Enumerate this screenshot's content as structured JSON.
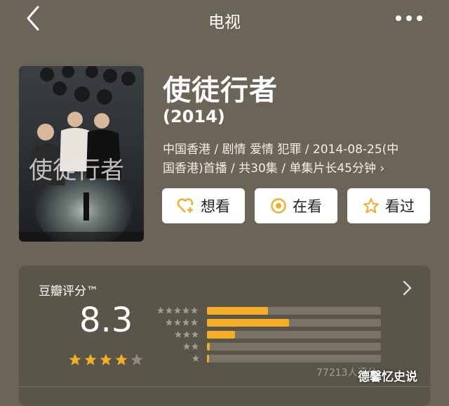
{
  "header": {
    "title": "电视",
    "back_icon": "chevron-left-icon",
    "more_icon": "more-dots-icon"
  },
  "show": {
    "title": "使徒行者",
    "year": "(2014)",
    "meta_line1": "中国香港 / 剧情 爱情 犯罪 / 2014-08-25(中",
    "meta_line2": "国香港)首播 / 共30集 / 单集片长45分钟",
    "poster_title": "使徒行者"
  },
  "actions": [
    {
      "label": "想看",
      "icon": "heart-plus-icon"
    },
    {
      "label": "在看",
      "icon": "target-circle-icon"
    },
    {
      "label": "看过",
      "icon": "star-outline-icon"
    }
  ],
  "rating": {
    "label": "豆瓣评分™",
    "score": "8.3",
    "stars_filled": 4,
    "stars_total": 5,
    "distribution": [
      {
        "stars": 5,
        "fraction": 0.35
      },
      {
        "stars": 4,
        "fraction": 0.47
      },
      {
        "stars": 3,
        "fraction": 0.16
      },
      {
        "stars": 2,
        "fraction": 0.015
      },
      {
        "stars": 1,
        "fraction": 0.004
      }
    ],
    "count": "77213人评分",
    "accent_color": "#f4ad25"
  },
  "watermark": "德馨忆史说"
}
